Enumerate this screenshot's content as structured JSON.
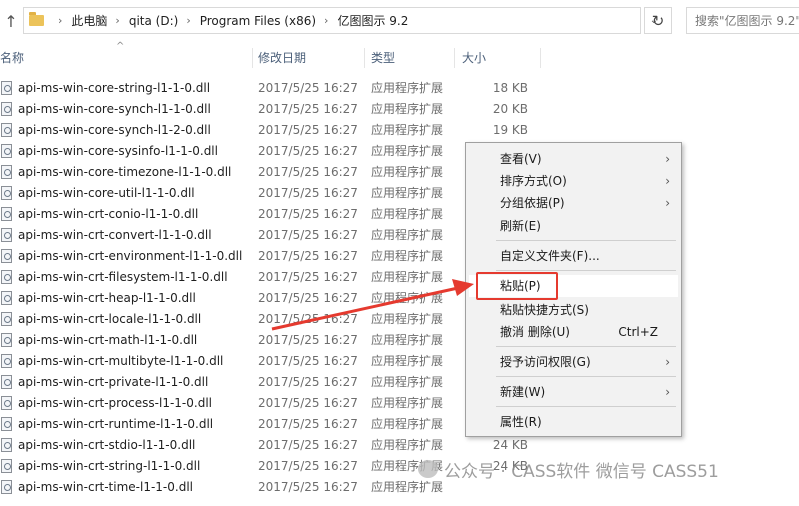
{
  "address_bar": {
    "crumbs": [
      "此电脑",
      "qita (D:)",
      "Program Files (x86)",
      "亿图图示 9.2"
    ],
    "search_placeholder": "搜索\"亿图图示 9.2\""
  },
  "columns": {
    "name": "名称",
    "date": "修改日期",
    "type": "类型",
    "size": "大小"
  },
  "files": [
    {
      "name": "api-ms-win-core-string-l1-1-0.dll",
      "date": "2017/5/25 16:27",
      "type": "应用程序扩展",
      "size": "18 KB"
    },
    {
      "name": "api-ms-win-core-synch-l1-1-0.dll",
      "date": "2017/5/25 16:27",
      "type": "应用程序扩展",
      "size": "20 KB"
    },
    {
      "name": "api-ms-win-core-synch-l1-2-0.dll",
      "date": "2017/5/25 16:27",
      "type": "应用程序扩展",
      "size": "19 KB"
    },
    {
      "name": "api-ms-win-core-sysinfo-l1-1-0.dll",
      "date": "2017/5/25 16:27",
      "type": "应用程序扩展",
      "size": ""
    },
    {
      "name": "api-ms-win-core-timezone-l1-1-0.dll",
      "date": "2017/5/25 16:27",
      "type": "应用程序扩展",
      "size": ""
    },
    {
      "name": "api-ms-win-core-util-l1-1-0.dll",
      "date": "2017/5/25 16:27",
      "type": "应用程序扩展",
      "size": ""
    },
    {
      "name": "api-ms-win-crt-conio-l1-1-0.dll",
      "date": "2017/5/25 16:27",
      "type": "应用程序扩展",
      "size": ""
    },
    {
      "name": "api-ms-win-crt-convert-l1-1-0.dll",
      "date": "2017/5/25 16:27",
      "type": "应用程序扩展",
      "size": ""
    },
    {
      "name": "api-ms-win-crt-environment-l1-1-0.dll",
      "date": "2017/5/25 16:27",
      "type": "应用程序扩展",
      "size": ""
    },
    {
      "name": "api-ms-win-crt-filesystem-l1-1-0.dll",
      "date": "2017/5/25 16:27",
      "type": "应用程序扩展",
      "size": ""
    },
    {
      "name": "api-ms-win-crt-heap-l1-1-0.dll",
      "date": "2017/5/25 16:27",
      "type": "应用程序扩展",
      "size": ""
    },
    {
      "name": "api-ms-win-crt-locale-l1-1-0.dll",
      "date": "2017/5/25 16:27",
      "type": "应用程序扩展",
      "size": ""
    },
    {
      "name": "api-ms-win-crt-math-l1-1-0.dll",
      "date": "2017/5/25 16:27",
      "type": "应用程序扩展",
      "size": ""
    },
    {
      "name": "api-ms-win-crt-multibyte-l1-1-0.dll",
      "date": "2017/5/25 16:27",
      "type": "应用程序扩展",
      "size": ""
    },
    {
      "name": "api-ms-win-crt-private-l1-1-0.dll",
      "date": "2017/5/25 16:27",
      "type": "应用程序扩展",
      "size": ""
    },
    {
      "name": "api-ms-win-crt-process-l1-1-0.dll",
      "date": "2017/5/25 16:27",
      "type": "应用程序扩展",
      "size": ""
    },
    {
      "name": "api-ms-win-crt-runtime-l1-1-0.dll",
      "date": "2017/5/25 16:27",
      "type": "应用程序扩展",
      "size": ""
    },
    {
      "name": "api-ms-win-crt-stdio-l1-1-0.dll",
      "date": "2017/5/25 16:27",
      "type": "应用程序扩展",
      "size": "24 KB"
    },
    {
      "name": "api-ms-win-crt-string-l1-1-0.dll",
      "date": "2017/5/25 16:27",
      "type": "应用程序扩展",
      "size": "24 KB"
    },
    {
      "name": "api-ms-win-crt-time-l1-1-0.dll",
      "date": "2017/5/25 16:27",
      "type": "应用程序扩展",
      "size": ""
    }
  ],
  "context_menu": {
    "view": "查看(V)",
    "sort": "排序方式(O)",
    "group": "分组依据(P)",
    "refresh": "刷新(E)",
    "customize": "自定义文件夹(F)...",
    "paste": "粘贴(P)",
    "paste_shortcut": "粘贴快捷方式(S)",
    "undo_delete": "撤消 删除(U)",
    "undo_shortcut": "Ctrl+Z",
    "grant_access": "授予访问权限(G)",
    "new": "新建(W)",
    "properties": "属性(R)"
  },
  "annotation_color": "#e53a2f",
  "watermark": {
    "text": "公众号 · CASS软件 微信号 CASS51"
  }
}
